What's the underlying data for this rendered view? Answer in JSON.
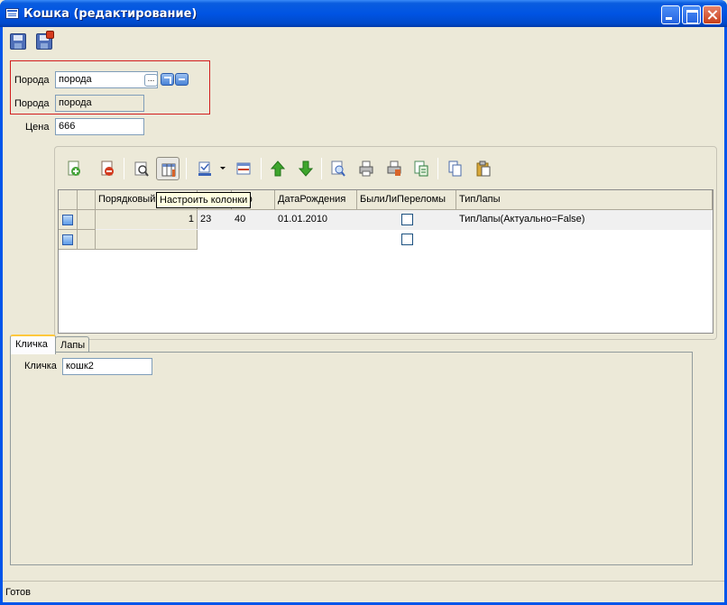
{
  "window": {
    "title": "Кошка (редактирование)"
  },
  "toolbar_top": {
    "icons": [
      "save-icon",
      "save-and-close-icon"
    ]
  },
  "form": {
    "breed_label": "Порода",
    "breed_value": "порода",
    "breed_label_2": "Порода",
    "breed_value_2": "порода",
    "price_label": "Цена",
    "price_value": "666"
  },
  "grid_toolbar": {
    "icons": [
      "add-icon",
      "delete-icon",
      "clear-filter-icon",
      "configure-columns-icon",
      "color-icon",
      "column-width-icon",
      "move-up-icon",
      "move-down-icon",
      "preview-icon",
      "print-icon",
      "print-settings-icon",
      "export-icon",
      "copy-icon",
      "paste-icon"
    ],
    "tooltip": "Настроить колонки"
  },
  "grid": {
    "columns": [
      "Порядковый",
      "",
      "мер",
      "ДатаРождения",
      "БылиЛиПереломы",
      "ТипЛапы"
    ],
    "rows": [
      {
        "ordinal": "1",
        "c1": "23",
        "c2": "40",
        "birth": "01.01.2010",
        "fractures": false,
        "paw_type": "ТипЛапы(Актуально=False)"
      },
      {
        "ordinal": "",
        "c1": "",
        "c2": "",
        "birth": "",
        "fractures": false,
        "paw_type": ""
      }
    ]
  },
  "tabs": [
    {
      "label": "Кличка",
      "active": true
    },
    {
      "label": "Лапы",
      "active": false
    }
  ],
  "tab_page": {
    "nickname_label": "Кличка",
    "nickname_value": "кошк2"
  },
  "status": {
    "text": "Готов"
  },
  "colors": {
    "titlebar": "#0054e3",
    "accent_red": "#d21e1e",
    "window_bg": "#ece9d8"
  }
}
